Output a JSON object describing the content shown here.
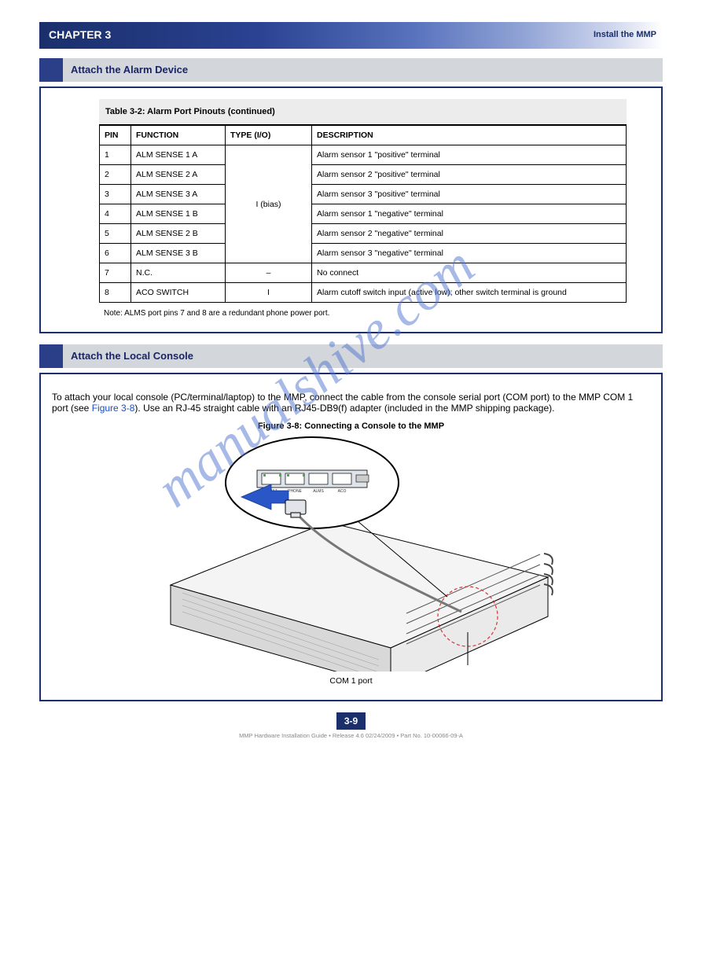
{
  "chapter": {
    "left": "CHAPTER 3",
    "right": "Install the MMP"
  },
  "section1": {
    "heading": "Attach the Alarm Device",
    "table_title": "Table 3-2: Alarm Port Pinouts (continued)",
    "columns": [
      "PIN",
      "FUNCTION",
      "TYPE (I/O)",
      "DESCRIPTION"
    ],
    "io_merged": "I (bias)",
    "rows": [
      {
        "pin": "1",
        "func": "ALM SENSE 1 A",
        "desc": "Alarm sensor 1 \"positive\" terminal"
      },
      {
        "pin": "2",
        "func": "ALM SENSE 2 A",
        "desc": "Alarm sensor 2 \"positive\" terminal"
      },
      {
        "pin": "3",
        "func": "ALM SENSE 3 A",
        "desc": "Alarm sensor 3 \"positive\" terminal"
      },
      {
        "pin": "4",
        "func": "ALM SENSE 1 B",
        "desc": "Alarm sensor 1 \"negative\" terminal"
      },
      {
        "pin": "5",
        "func": "ALM SENSE 2 B",
        "desc": "Alarm sensor 2 \"negative\" terminal"
      },
      {
        "pin": "6",
        "func": "ALM SENSE 3 B",
        "desc": "Alarm sensor 3 \"negative\" terminal"
      },
      {
        "pin": "7",
        "func": "N.C.",
        "io": "–",
        "desc": "No connect"
      },
      {
        "pin": "8",
        "func": "ACO SWITCH",
        "io": "I",
        "desc": "Alarm cutoff switch input (active low); other switch terminal is ground"
      }
    ],
    "note": "Note: ALMS port pins 7 and 8 are a redundant phone power port."
  },
  "section2": {
    "heading": "Attach the Local Console",
    "intro": "To attach your local console (PC/terminal/laptop) to the MMP, connect the cable from the console serial port (COM port) to the MMP COM 1 port (see ",
    "intro_link": "Figure 3-8",
    "intro_after": "). Use an RJ-45 straight cable with an RJ45-DB9(f) adapter (included in the MMP shipping package).",
    "figure_caption": "Figure 3-8: Connecting a Console to the MMP",
    "figure_label": "COM 1 port"
  },
  "footer": {
    "page": "3-9",
    "legal": "MMP Hardware Installation Guide  •  Release 4.6  02/24/2009  •  Part No. 10-00066-09-A"
  }
}
